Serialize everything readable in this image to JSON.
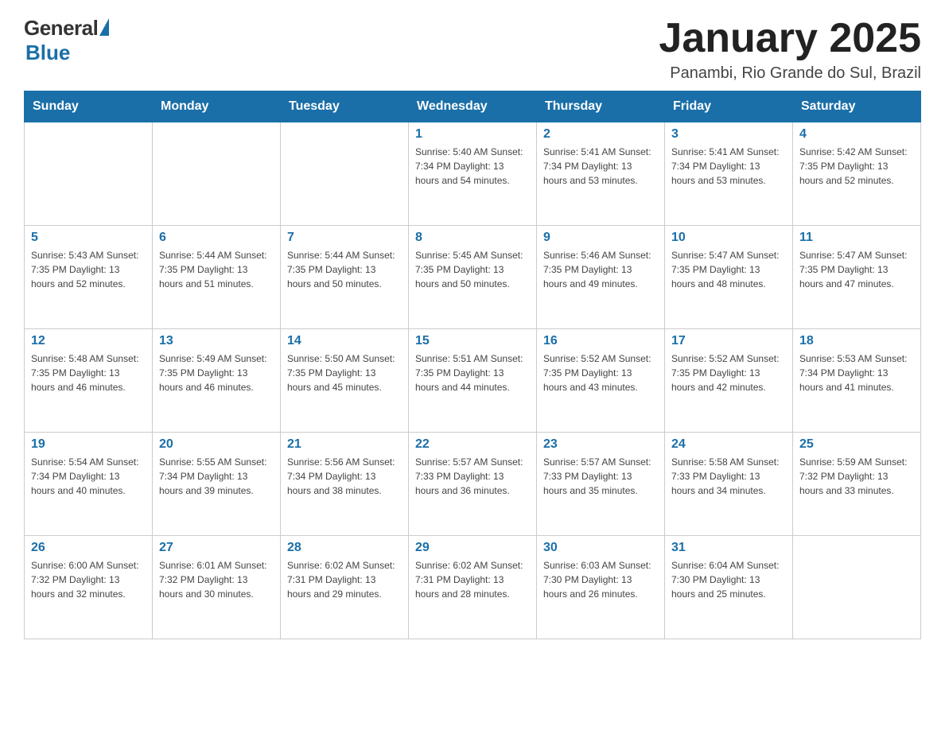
{
  "logo": {
    "general": "General",
    "blue": "Blue"
  },
  "header": {
    "month": "January 2025",
    "location": "Panambi, Rio Grande do Sul, Brazil"
  },
  "weekdays": [
    "Sunday",
    "Monday",
    "Tuesday",
    "Wednesday",
    "Thursday",
    "Friday",
    "Saturday"
  ],
  "weeks": [
    [
      {
        "day": "",
        "info": ""
      },
      {
        "day": "",
        "info": ""
      },
      {
        "day": "",
        "info": ""
      },
      {
        "day": "1",
        "info": "Sunrise: 5:40 AM\nSunset: 7:34 PM\nDaylight: 13 hours\nand 54 minutes."
      },
      {
        "day": "2",
        "info": "Sunrise: 5:41 AM\nSunset: 7:34 PM\nDaylight: 13 hours\nand 53 minutes."
      },
      {
        "day": "3",
        "info": "Sunrise: 5:41 AM\nSunset: 7:34 PM\nDaylight: 13 hours\nand 53 minutes."
      },
      {
        "day": "4",
        "info": "Sunrise: 5:42 AM\nSunset: 7:35 PM\nDaylight: 13 hours\nand 52 minutes."
      }
    ],
    [
      {
        "day": "5",
        "info": "Sunrise: 5:43 AM\nSunset: 7:35 PM\nDaylight: 13 hours\nand 52 minutes."
      },
      {
        "day": "6",
        "info": "Sunrise: 5:44 AM\nSunset: 7:35 PM\nDaylight: 13 hours\nand 51 minutes."
      },
      {
        "day": "7",
        "info": "Sunrise: 5:44 AM\nSunset: 7:35 PM\nDaylight: 13 hours\nand 50 minutes."
      },
      {
        "day": "8",
        "info": "Sunrise: 5:45 AM\nSunset: 7:35 PM\nDaylight: 13 hours\nand 50 minutes."
      },
      {
        "day": "9",
        "info": "Sunrise: 5:46 AM\nSunset: 7:35 PM\nDaylight: 13 hours\nand 49 minutes."
      },
      {
        "day": "10",
        "info": "Sunrise: 5:47 AM\nSunset: 7:35 PM\nDaylight: 13 hours\nand 48 minutes."
      },
      {
        "day": "11",
        "info": "Sunrise: 5:47 AM\nSunset: 7:35 PM\nDaylight: 13 hours\nand 47 minutes."
      }
    ],
    [
      {
        "day": "12",
        "info": "Sunrise: 5:48 AM\nSunset: 7:35 PM\nDaylight: 13 hours\nand 46 minutes."
      },
      {
        "day": "13",
        "info": "Sunrise: 5:49 AM\nSunset: 7:35 PM\nDaylight: 13 hours\nand 46 minutes."
      },
      {
        "day": "14",
        "info": "Sunrise: 5:50 AM\nSunset: 7:35 PM\nDaylight: 13 hours\nand 45 minutes."
      },
      {
        "day": "15",
        "info": "Sunrise: 5:51 AM\nSunset: 7:35 PM\nDaylight: 13 hours\nand 44 minutes."
      },
      {
        "day": "16",
        "info": "Sunrise: 5:52 AM\nSunset: 7:35 PM\nDaylight: 13 hours\nand 43 minutes."
      },
      {
        "day": "17",
        "info": "Sunrise: 5:52 AM\nSunset: 7:35 PM\nDaylight: 13 hours\nand 42 minutes."
      },
      {
        "day": "18",
        "info": "Sunrise: 5:53 AM\nSunset: 7:34 PM\nDaylight: 13 hours\nand 41 minutes."
      }
    ],
    [
      {
        "day": "19",
        "info": "Sunrise: 5:54 AM\nSunset: 7:34 PM\nDaylight: 13 hours\nand 40 minutes."
      },
      {
        "day": "20",
        "info": "Sunrise: 5:55 AM\nSunset: 7:34 PM\nDaylight: 13 hours\nand 39 minutes."
      },
      {
        "day": "21",
        "info": "Sunrise: 5:56 AM\nSunset: 7:34 PM\nDaylight: 13 hours\nand 38 minutes."
      },
      {
        "day": "22",
        "info": "Sunrise: 5:57 AM\nSunset: 7:33 PM\nDaylight: 13 hours\nand 36 minutes."
      },
      {
        "day": "23",
        "info": "Sunrise: 5:57 AM\nSunset: 7:33 PM\nDaylight: 13 hours\nand 35 minutes."
      },
      {
        "day": "24",
        "info": "Sunrise: 5:58 AM\nSunset: 7:33 PM\nDaylight: 13 hours\nand 34 minutes."
      },
      {
        "day": "25",
        "info": "Sunrise: 5:59 AM\nSunset: 7:32 PM\nDaylight: 13 hours\nand 33 minutes."
      }
    ],
    [
      {
        "day": "26",
        "info": "Sunrise: 6:00 AM\nSunset: 7:32 PM\nDaylight: 13 hours\nand 32 minutes."
      },
      {
        "day": "27",
        "info": "Sunrise: 6:01 AM\nSunset: 7:32 PM\nDaylight: 13 hours\nand 30 minutes."
      },
      {
        "day": "28",
        "info": "Sunrise: 6:02 AM\nSunset: 7:31 PM\nDaylight: 13 hours\nand 29 minutes."
      },
      {
        "day": "29",
        "info": "Sunrise: 6:02 AM\nSunset: 7:31 PM\nDaylight: 13 hours\nand 28 minutes."
      },
      {
        "day": "30",
        "info": "Sunrise: 6:03 AM\nSunset: 7:30 PM\nDaylight: 13 hours\nand 26 minutes."
      },
      {
        "day": "31",
        "info": "Sunrise: 6:04 AM\nSunset: 7:30 PM\nDaylight: 13 hours\nand 25 minutes."
      },
      {
        "day": "",
        "info": ""
      }
    ]
  ]
}
